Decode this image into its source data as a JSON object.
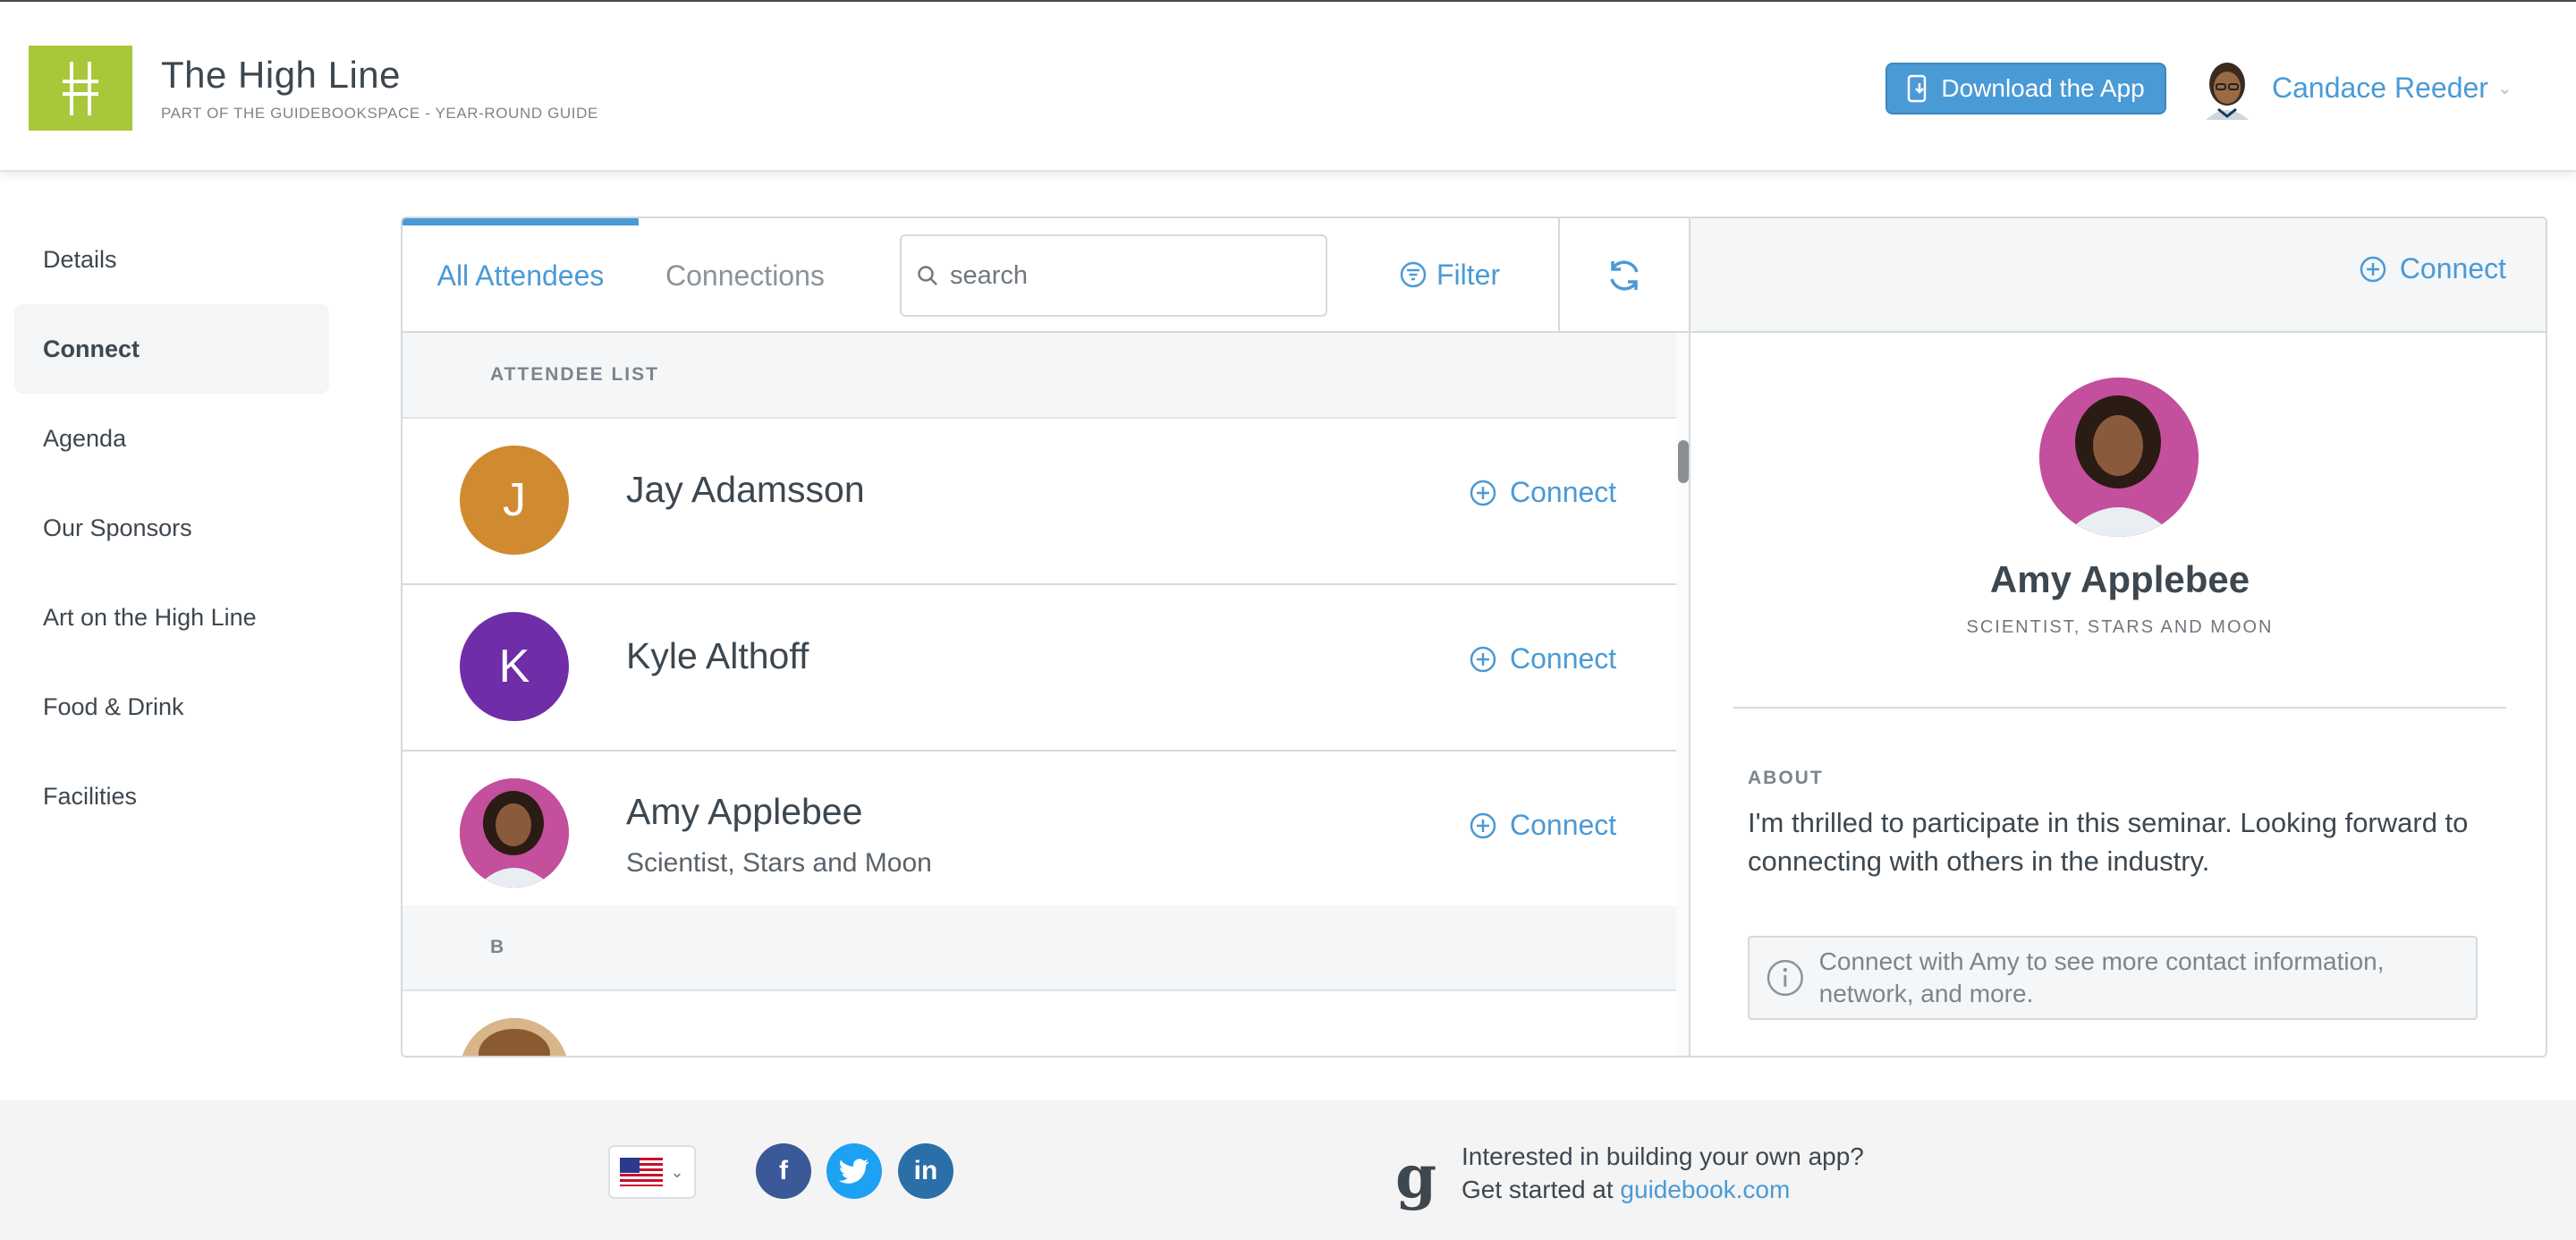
{
  "header": {
    "title": "The High Line",
    "subtitle": "PART OF THE GUIDEBOOKSPACE - YEAR-ROUND GUIDE",
    "download_label": "Download the App",
    "user_name": "Candace Reeder"
  },
  "sidebar": {
    "items": [
      {
        "label": "Details"
      },
      {
        "label": "Connect"
      },
      {
        "label": "Agenda"
      },
      {
        "label": "Our Sponsors"
      },
      {
        "label": "Art on the High Line"
      },
      {
        "label": "Food & Drink"
      },
      {
        "label": "Facilities"
      }
    ],
    "active": "Connect"
  },
  "toolbar": {
    "tab_all": "All Attendees",
    "tab_connections": "Connections",
    "search_placeholder": "search",
    "filter_label": "Filter"
  },
  "list": {
    "section_a": "ATTENDEE LIST",
    "section_b": "B",
    "connect_label": "Connect",
    "attendees": [
      {
        "initial": "J",
        "name": "Jay Adamsson",
        "subtitle": "",
        "color": "#d08a2f"
      },
      {
        "initial": "K",
        "name": "Kyle Althoff",
        "subtitle": "",
        "color": "#6f2da8"
      },
      {
        "initial": "",
        "name": "Amy Applebee",
        "subtitle": "Scientist, Stars and Moon",
        "color": "#c44f9c"
      }
    ]
  },
  "detail": {
    "connect_label": "Connect",
    "name": "Amy Applebee",
    "title": "SCIENTIST, STARS AND MOON",
    "about_label": "ABOUT",
    "about_text": "I'm thrilled to participate in this seminar. Looking forward to connecting with others in the industry.",
    "info_text": "Connect with Amy to see more contact information, network, and more."
  },
  "footer": {
    "social": {
      "facebook": "f",
      "linkedin": "in"
    },
    "gb_logo": "g",
    "line1": "Interested in building your own app?",
    "line2_prefix": "Get started at ",
    "link_text": "guidebook.com"
  },
  "colors": {
    "accent": "#4a9ad6",
    "logo_green": "#a9c73a"
  }
}
